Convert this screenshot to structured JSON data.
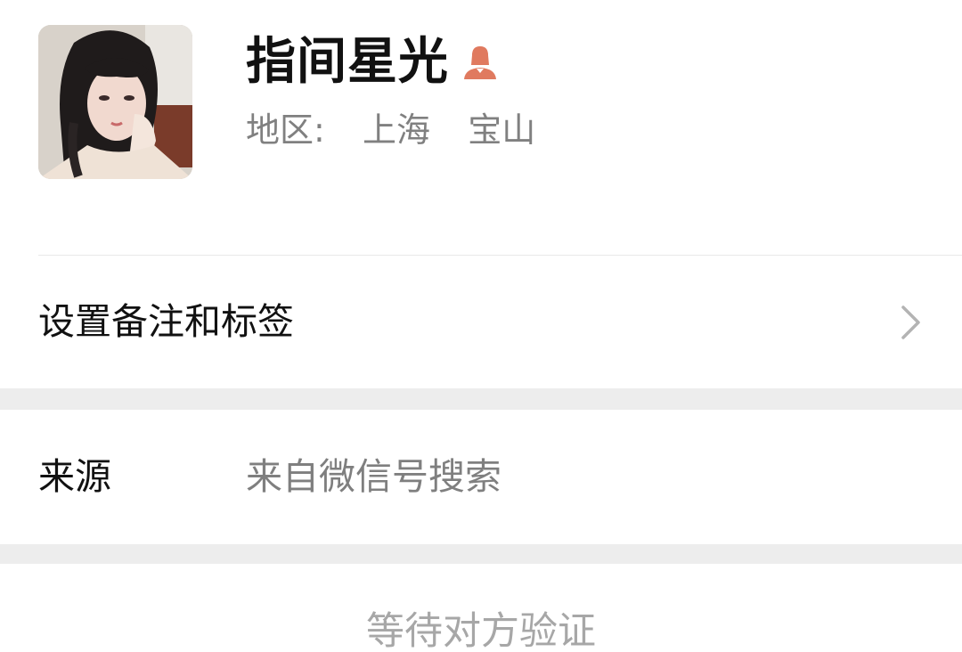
{
  "profile": {
    "nickname": "指间星光",
    "gender_icon": "female-person-icon",
    "region_label": "地区:",
    "region_city": "上海",
    "region_district": "宝山"
  },
  "remark": {
    "label": "设置备注和标签",
    "chevron_icon": "chevron-right-icon"
  },
  "source": {
    "label": "来源",
    "value": "来自微信号搜索"
  },
  "pending": {
    "label": "等待对方验证"
  },
  "colors": {
    "gender_icon": "#e07a5f",
    "section_gap": "#ededed",
    "secondary_text": "#808080"
  }
}
